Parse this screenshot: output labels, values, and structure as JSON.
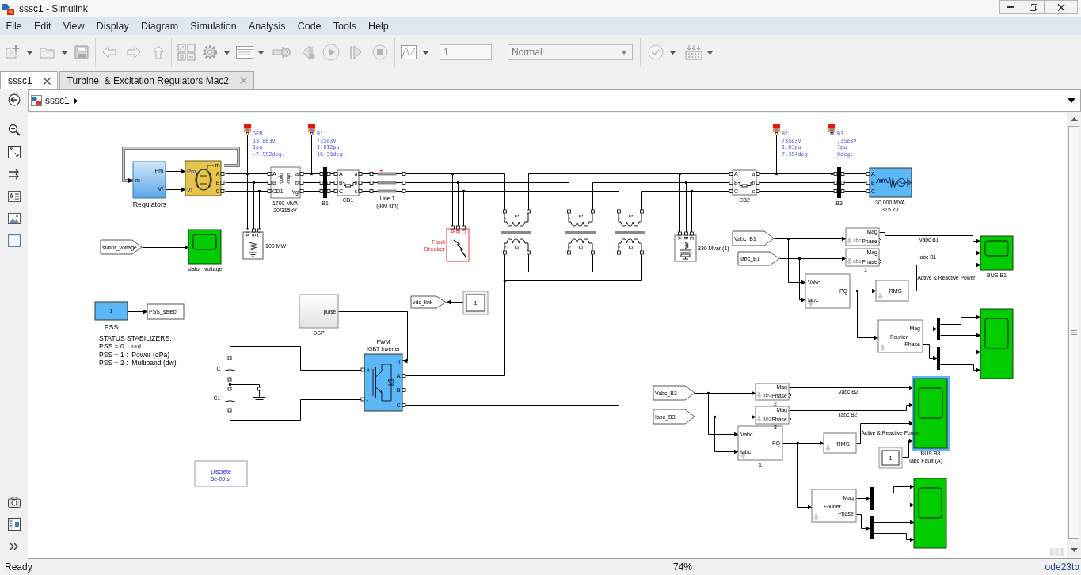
{
  "window": {
    "title": "sssc1 - Simulink"
  },
  "menu": [
    "File",
    "Edit",
    "View",
    "Display",
    "Diagram",
    "Simulation",
    "Analysis",
    "Code",
    "Tools",
    "Help"
  ],
  "toolbar": {
    "stop_time": "1",
    "simulation_mode": "Normal"
  },
  "tabs": [
    {
      "label": "sssc1",
      "selected": true
    },
    {
      "label": "Turbine  & Excitation Regulators Mac2",
      "selected": false
    }
  ],
  "breadcrumb": [
    "sssc1"
  ],
  "diagram": {
    "regulators": {
      "caption": "Regulators",
      "inputs": [
        "m"
      ],
      "outputs": [
        "Pm",
        "Vf"
      ]
    },
    "machine": {
      "inputs": [
        "Pm",
        "Vf"
      ],
      "outputs": [
        "m",
        "A",
        "B",
        "C"
      ]
    },
    "bus_probes": [
      {
        "lines": [
          "GEN",
          "13.8e3V",
          "1pu",
          "-7.552deg."
        ]
      },
      {
        "lines": [
          "B1",
          "735e3V",
          "1.012pu",
          "16.39deg."
        ]
      },
      {
        "lines": [
          "B2",
          "735e3V",
          "1.03pu",
          "7.354deg."
        ]
      },
      {
        "lines": [
          "B3",
          "735e3V",
          "1pu",
          "0deg."
        ]
      }
    ],
    "transformer": {
      "caption": [
        "1700 MVA",
        "20/315kV"
      ],
      "left_ports": [
        "A",
        "B",
        "C"
      ],
      "primary": "D1",
      "right_ports": [
        "a",
        "b"
      ],
      "secondary": "Yg"
    },
    "load": {
      "ports": [
        "A",
        "B",
        "C"
      ],
      "caption": "100 MW"
    },
    "buses": [
      {
        "caption": "B1"
      },
      {
        "caption": "B3"
      }
    ],
    "breakers": [
      {
        "caption": "CB1",
        "left_ports": [
          "A",
          "B",
          "C"
        ],
        "right_ports": [
          "a",
          "b",
          "c"
        ]
      },
      {
        "caption": "CB2",
        "left_ports": [
          "A",
          "B",
          "C"
        ],
        "right_ports": [
          "a",
          "b",
          "c"
        ]
      }
    ],
    "line": {
      "caption": [
        "Line 1",
        "(400 km)"
      ]
    },
    "fault": {
      "ports": [
        "A",
        "B",
        "C"
      ],
      "caption": [
        "Fault",
        "Breaker"
      ]
    },
    "series_transformers": [
      {
        "windings": [
          "1",
          "2"
        ]
      },
      {
        "windings": [
          "1",
          "2"
        ]
      },
      {
        "windings": [
          "1",
          "2"
        ]
      }
    ],
    "shunt": {
      "ports": [
        "A",
        "B",
        "C"
      ],
      "caption": "330 Mvar (1)"
    },
    "source": {
      "ports": [
        "A",
        "B",
        "C"
      ],
      "caption": [
        "30,000 MVA",
        "315 kV"
      ]
    },
    "tags": [
      {
        "kind": "flag",
        "text": "stator_voltage"
      },
      {
        "kind": "box",
        "text": "PSS_select"
      },
      {
        "kind": "flag",
        "text": "vdc_link"
      },
      {
        "kind": "flag",
        "text": "Vabc_B1"
      },
      {
        "kind": "flag",
        "text": "Iabc_B1"
      },
      {
        "kind": "flag",
        "text": "Vabc_B3"
      },
      {
        "kind": "flag",
        "text": "Iabc_B3"
      }
    ],
    "scopes": [
      {
        "caption": "stator_voltage",
        "selected": false
      },
      {
        "caption": "BUS B1",
        "selected": false
      },
      {
        "selected": false
      },
      {
        "caption": "BUS B3",
        "selected": true
      },
      {
        "selected": false
      }
    ],
    "constant": {
      "value": "1",
      "caption": "PSS"
    },
    "note": [
      "STATUS STABILIZERS:",
      "PSS = 0 :  out",
      "PSS = 1 :  Power (dPa)",
      "PSS = 2 :  Multiband (dw)"
    ],
    "dsp": {
      "output": "pulse",
      "caption": "DSP"
    },
    "displays": [
      {
        "value": "1"
      },
      {
        "value": "1",
        "caption": "Iabc Fault (A)"
      }
    ],
    "inverter": {
      "caption": [
        "PWM",
        "IGBT Inverter"
      ],
      "left_ports": [
        "+",
        "-"
      ],
      "right_ports": [
        "g",
        "A",
        "B",
        "C"
      ]
    },
    "capacitors": [
      {
        "caption": "C"
      },
      {
        "caption": "C1"
      }
    ],
    "powergui": [
      "Discrete",
      "5e-05 s."
    ],
    "mag_phase": [
      {
        "icon_text": "abc",
        "outputs": [
          "Mag",
          "Phase"
        ]
      },
      {
        "icon_text": "abc",
        "outputs": [
          "Mag",
          "Phase"
        ],
        "caption": "1"
      },
      {
        "icon_text": "abc",
        "outputs": [
          "Mag",
          "Phase"
        ],
        "caption": "2"
      },
      {
        "icon_text": "abc",
        "outputs": [
          "Mag",
          "Phase"
        ],
        "caption": "3"
      }
    ],
    "power_meters": [
      {
        "inputs": [
          "Vabc",
          "Iabc"
        ],
        "output": "PQ"
      },
      {
        "inputs": [
          "Vabc",
          "Iabc"
        ],
        "output": "PQ",
        "caption": "1"
      }
    ],
    "rms": [
      {
        "text": "RMS"
      },
      {
        "text": "RMS"
      }
    ],
    "fourier": [
      {
        "text": "Fourier",
        "outputs": [
          "Mag",
          "Phase"
        ]
      },
      {
        "text": "Fourier",
        "outputs": [
          "Mag",
          "Phase"
        ]
      }
    ],
    "signal_labels": [
      "Vabc B1",
      "Iabc B1",
      "Active & Reactive Power",
      "Vabc B2",
      "Iabc B2",
      "Active & Reactive Power"
    ]
  },
  "status_bar": {
    "message": "Ready",
    "zoom": "74%",
    "solver": "ode23tb"
  }
}
